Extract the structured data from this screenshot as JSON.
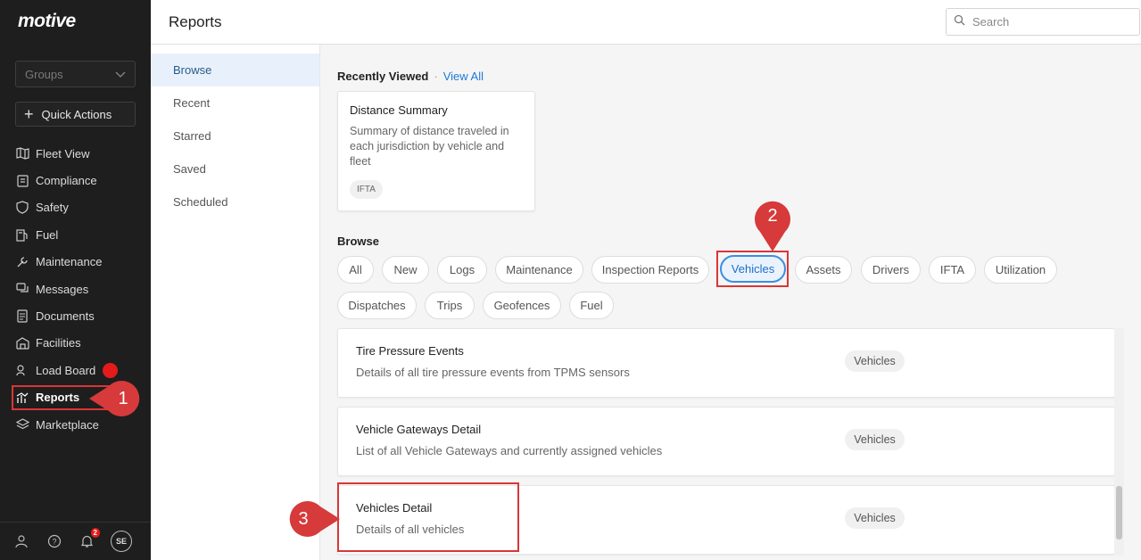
{
  "brand": {
    "logo_text": "motive"
  },
  "sidebar": {
    "groups_placeholder": "Groups",
    "quick_actions_label": "Quick Actions",
    "items": [
      {
        "label": "Fleet View",
        "icon": "map-icon"
      },
      {
        "label": "Compliance",
        "icon": "clipboard-icon"
      },
      {
        "label": "Safety",
        "icon": "shield-icon"
      },
      {
        "label": "Fuel",
        "icon": "fuel-icon"
      },
      {
        "label": "Maintenance",
        "icon": "wrench-icon"
      },
      {
        "label": "Messages",
        "icon": "messages-icon"
      },
      {
        "label": "Documents",
        "icon": "document-icon"
      },
      {
        "label": "Facilities",
        "icon": "facility-icon"
      },
      {
        "label": "Load Board",
        "icon": "load-board-icon"
      },
      {
        "label": "Reports",
        "icon": "reports-icon"
      },
      {
        "label": "Marketplace",
        "icon": "marketplace-icon"
      }
    ],
    "notification_count": "2",
    "avatar_initials": "SE"
  },
  "header": {
    "title": "Reports",
    "search_placeholder": "Search"
  },
  "subnav": {
    "items": [
      "Browse",
      "Recent",
      "Starred",
      "Saved",
      "Scheduled"
    ],
    "active": "Browse"
  },
  "recently_viewed": {
    "heading": "Recently Viewed",
    "separator": "·",
    "view_all": "View All",
    "card": {
      "title": "Distance Summary",
      "description": "Summary of distance traveled in each jurisdiction by vehicle and fleet",
      "tag": "IFTA"
    }
  },
  "browse": {
    "heading": "Browse",
    "chips": [
      "All",
      "New",
      "Logs",
      "Maintenance",
      "Inspection Reports",
      "Vehicles",
      "Assets",
      "Drivers",
      "IFTA",
      "Utilization",
      "Dispatches",
      "Trips",
      "Geofences",
      "Fuel"
    ],
    "active_chip": "Vehicles"
  },
  "reports_list": [
    {
      "title": "Tire Pressure Events",
      "description": "Details of all tire pressure events from TPMS sensors",
      "tag": "Vehicles"
    },
    {
      "title": "Vehicle Gateways Detail",
      "description": "List of all Vehicle Gateways and currently assigned vehicles",
      "tag": "Vehicles"
    },
    {
      "title": "Vehicles Detail",
      "description": "Details of all vehicles",
      "tag": "Vehicles"
    }
  ],
  "step_markers": [
    "1",
    "2",
    "3"
  ],
  "colors": {
    "highlight": "#d93636",
    "marker": "#d63a3a",
    "link": "#1e7ad6",
    "sidebar_bg": "#1e1e1e"
  }
}
